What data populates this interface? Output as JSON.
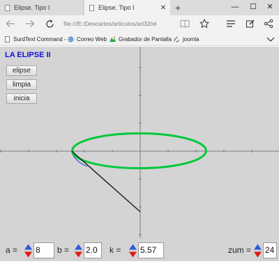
{
  "browser": {
    "tabs": [
      {
        "title": "Elipse. Tipo I"
      },
      {
        "title": "Elipse. Tipo I"
      }
    ],
    "new_tab": "+",
    "window_controls": {
      "minimize": "—",
      "maximize": "☐",
      "close": "✕"
    },
    "address": "file:///E:/Descartes/articulos/art32/el"
  },
  "favorites": [
    {
      "label": "SurdText Command -"
    },
    {
      "label": "Correo Web"
    },
    {
      "label": "Grabador de Pantalla"
    },
    {
      "label": "joomla"
    }
  ],
  "app": {
    "title": "LA ELIPSE II",
    "buttons": {
      "ellipse": "elipse",
      "clear": "limpia",
      "reset": "inicia"
    }
  },
  "params": {
    "a": {
      "label": "a =",
      "value": "8"
    },
    "b": {
      "label": "b =",
      "value": "2.0"
    },
    "k": {
      "label": "k =",
      "value": "5.57"
    },
    "zoom": {
      "label": "zum =",
      "value": "24"
    }
  },
  "colors": {
    "title": "#1010e0",
    "ellipse": "#00c83c",
    "trace": "#4060d0",
    "segment": "#202020",
    "axis": "#7c7c7c",
    "canvas": "#d4d4d4"
  }
}
